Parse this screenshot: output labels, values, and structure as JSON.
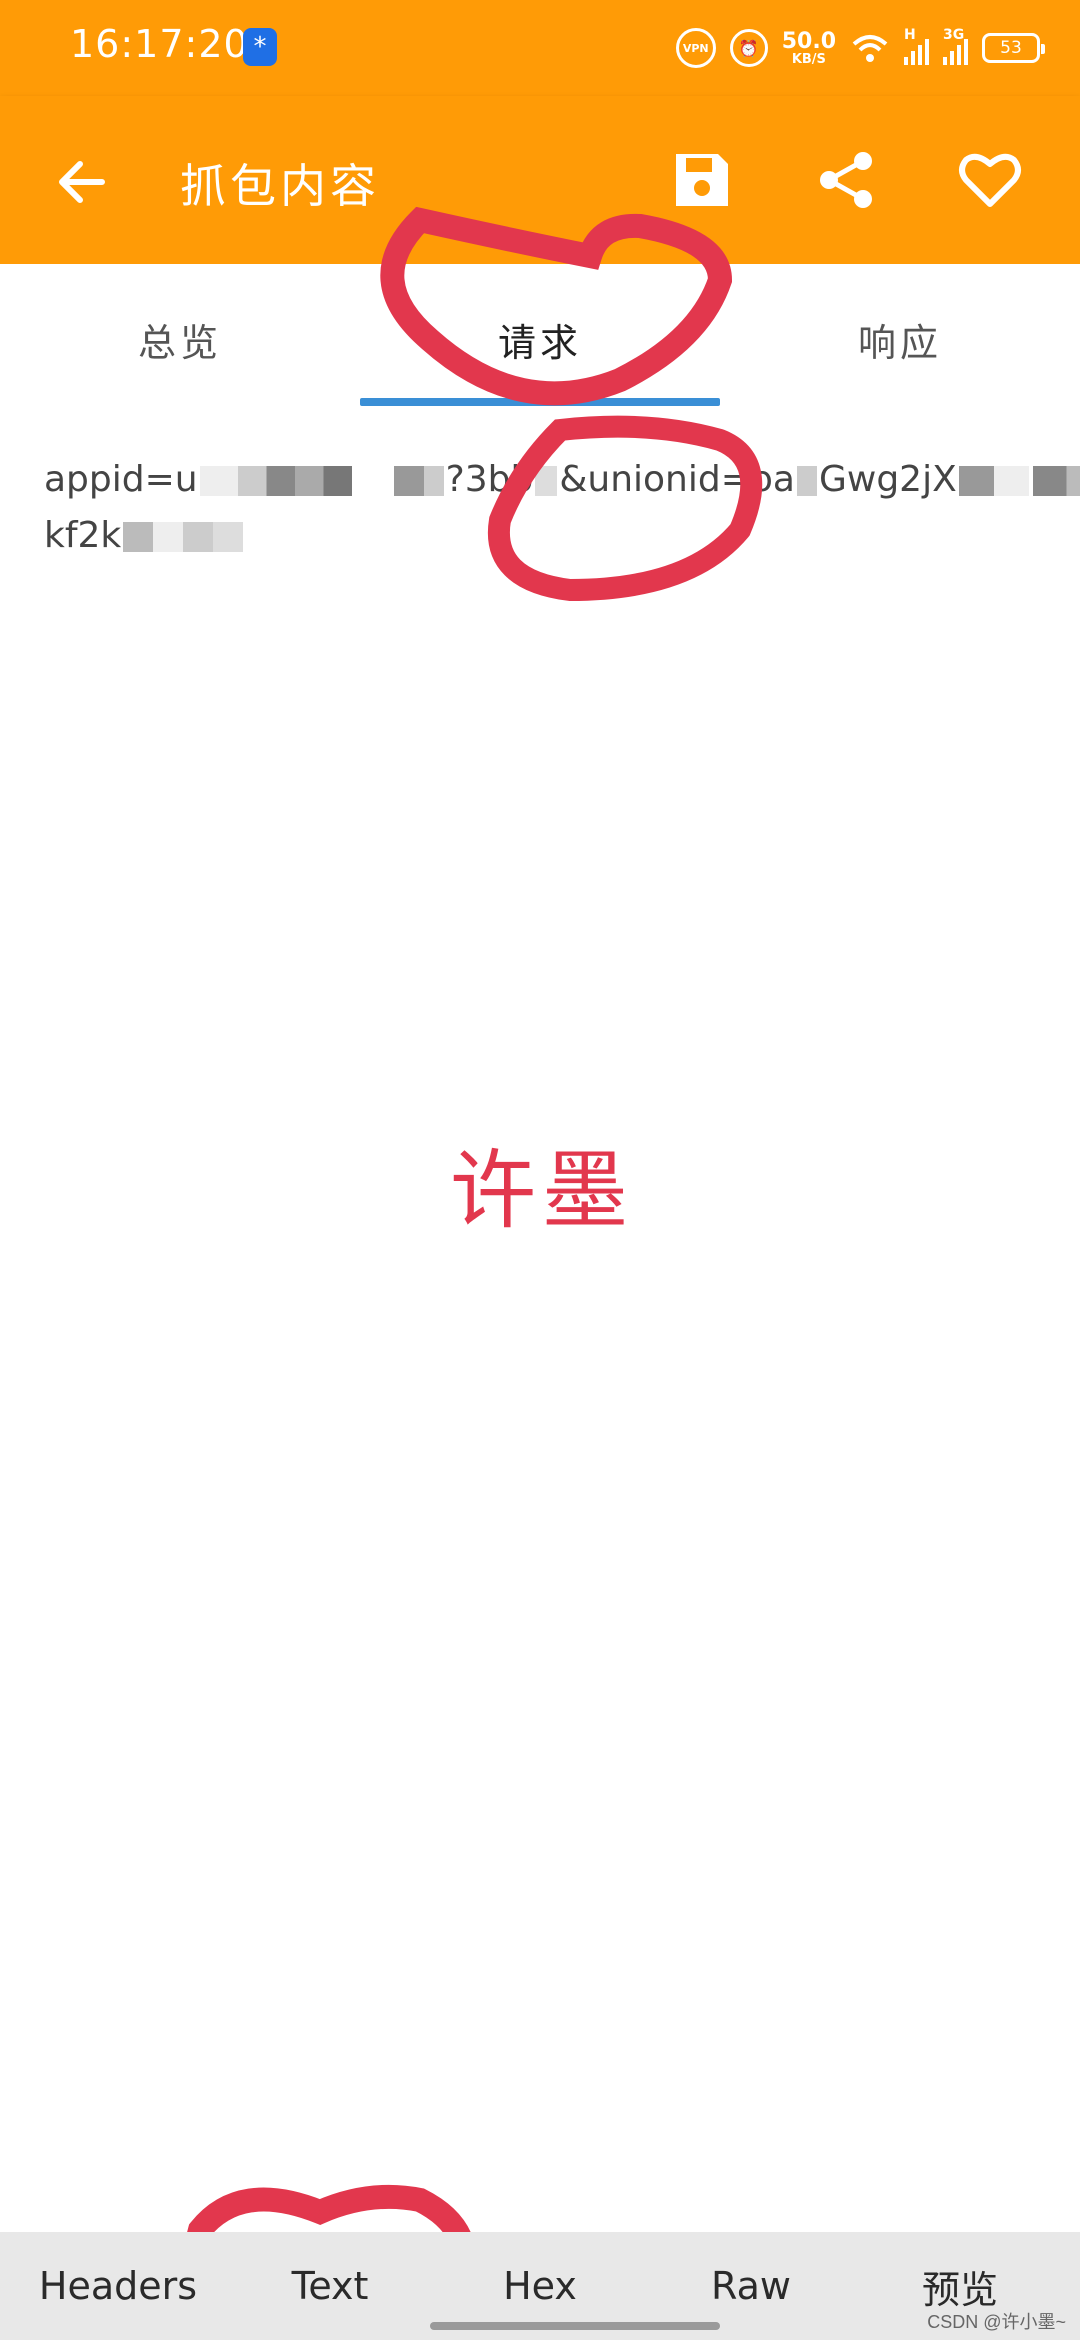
{
  "status_bar": {
    "time": "16:17:20",
    "app_icon_glyph": "*",
    "vpn_label": "VPN",
    "speed_value": "50.0",
    "speed_unit": "KB/S",
    "signal1_tag": "H",
    "signal2_tag": "3G",
    "battery_level": "53"
  },
  "toolbar": {
    "title": "抓包内容",
    "back_icon": "arrow-back-icon",
    "save_icon": "save-icon",
    "share_icon": "share-icon",
    "favorite_icon": "heart-outline-icon"
  },
  "top_tabs": {
    "items": [
      {
        "label": "总览"
      },
      {
        "label": "请求"
      },
      {
        "label": "响应"
      }
    ],
    "active_index": 1
  },
  "content": {
    "line1_a": "appid=u",
    "line1_b": "?3bb",
    "line1_c": "&unionid=oa",
    "line1_d": "Gwg2jX",
    "line2_a": "kf2k"
  },
  "watermark": "许墨",
  "bottom_tabs": {
    "items": [
      {
        "label": "Headers"
      },
      {
        "label": "Text"
      },
      {
        "label": "Hex"
      },
      {
        "label": "Raw"
      },
      {
        "label": "预览"
      }
    ]
  },
  "credit": "CSDN @许小墨~",
  "colors": {
    "accent": "#ff9b06",
    "tab_indicator": "#3a8fd6",
    "annotation_red": "#e2374d",
    "bottom_bar": "#e8e8e8"
  }
}
